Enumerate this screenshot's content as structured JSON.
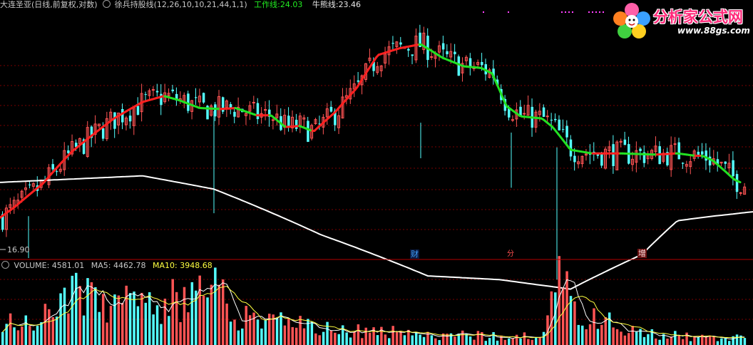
{
  "header": {
    "stock": "大连圣亚(日线,前复权,对数)",
    "indicator": "徐兵持股线(12,26,10,10,21,44,1,1)",
    "work_line_label": "工作线:",
    "work_line_value": "24.03",
    "bull_line_label": "牛熊线:",
    "bull_line_value": "23.46"
  },
  "low_price_label": "16.90",
  "event_markers": [
    "财",
    "分",
    "增"
  ],
  "volume_header": {
    "volume_label": "VOLUME:",
    "volume_value": "4581.01",
    "ma5_label": "MA5:",
    "ma5_value": "4462.78",
    "ma10_label": "MA10:",
    "ma10_value": "3948.68"
  },
  "watermark": {
    "title": "分析家公式网",
    "url": "www.88gs.com"
  },
  "colors": {
    "up_candle": "#ff5454",
    "down_candle": "#54ffff",
    "work_line_up": "#ff2020",
    "work_line_down": "#22e022",
    "bull_line": "#ffffff",
    "work_label": "#22ee22",
    "ma10": "#ffff40",
    "grid": "#7a0000"
  },
  "chart_data": {
    "type": "candlestick",
    "price_scale": "log",
    "price_axis_min": 16.9,
    "work_line_points": [
      [
        0,
        18.9
      ],
      [
        20,
        19.6
      ],
      [
        60,
        21.3
      ],
      [
        100,
        23.8
      ],
      [
        130,
        25.3
      ],
      [
        160,
        26.8
      ],
      [
        200,
        28.4
      ],
      [
        230,
        29.0
      ],
      [
        250,
        28.6
      ],
      [
        280,
        27.8
      ],
      [
        310,
        27.7
      ],
      [
        330,
        27.8
      ],
      [
        360,
        27.1
      ],
      [
        380,
        27.1
      ],
      [
        400,
        26.0
      ],
      [
        420,
        26.1
      ],
      [
        440,
        25.6
      ],
      [
        470,
        27.4
      ],
      [
        500,
        29.8
      ],
      [
        530,
        33.5
      ],
      [
        560,
        34.3
      ],
      [
        590,
        34.8
      ],
      [
        620,
        33.2
      ],
      [
        650,
        32.2
      ],
      [
        675,
        32.0
      ],
      [
        690,
        31.4
      ],
      [
        710,
        28.0
      ],
      [
        730,
        27.0
      ],
      [
        760,
        26.8
      ],
      [
        775,
        26.0
      ],
      [
        800,
        24.0
      ],
      [
        830,
        23.7
      ],
      [
        870,
        23.7
      ],
      [
        920,
        23.6
      ],
      [
        950,
        23.7
      ],
      [
        975,
        23.5
      ],
      [
        985,
        23.5
      ],
      [
        1000,
        23.1
      ],
      [
        1030,
        21.6
      ],
      [
        1056,
        21.0
      ]
    ],
    "bull_line_points": [
      [
        0,
        21.4
      ],
      [
        200,
        21.9
      ],
      [
        300,
        20.9
      ],
      [
        450,
        17.8
      ],
      [
        600,
        15.4
      ],
      [
        700,
        15.2
      ],
      [
        800,
        14.7
      ],
      [
        900,
        16.6
      ],
      [
        950,
        18.7
      ],
      [
        1000,
        19.0
      ],
      [
        1056,
        19.3
      ]
    ],
    "volume_header_values": {
      "volume": 4581.01,
      "ma5": 4462.78,
      "ma10": 3948.68
    }
  }
}
